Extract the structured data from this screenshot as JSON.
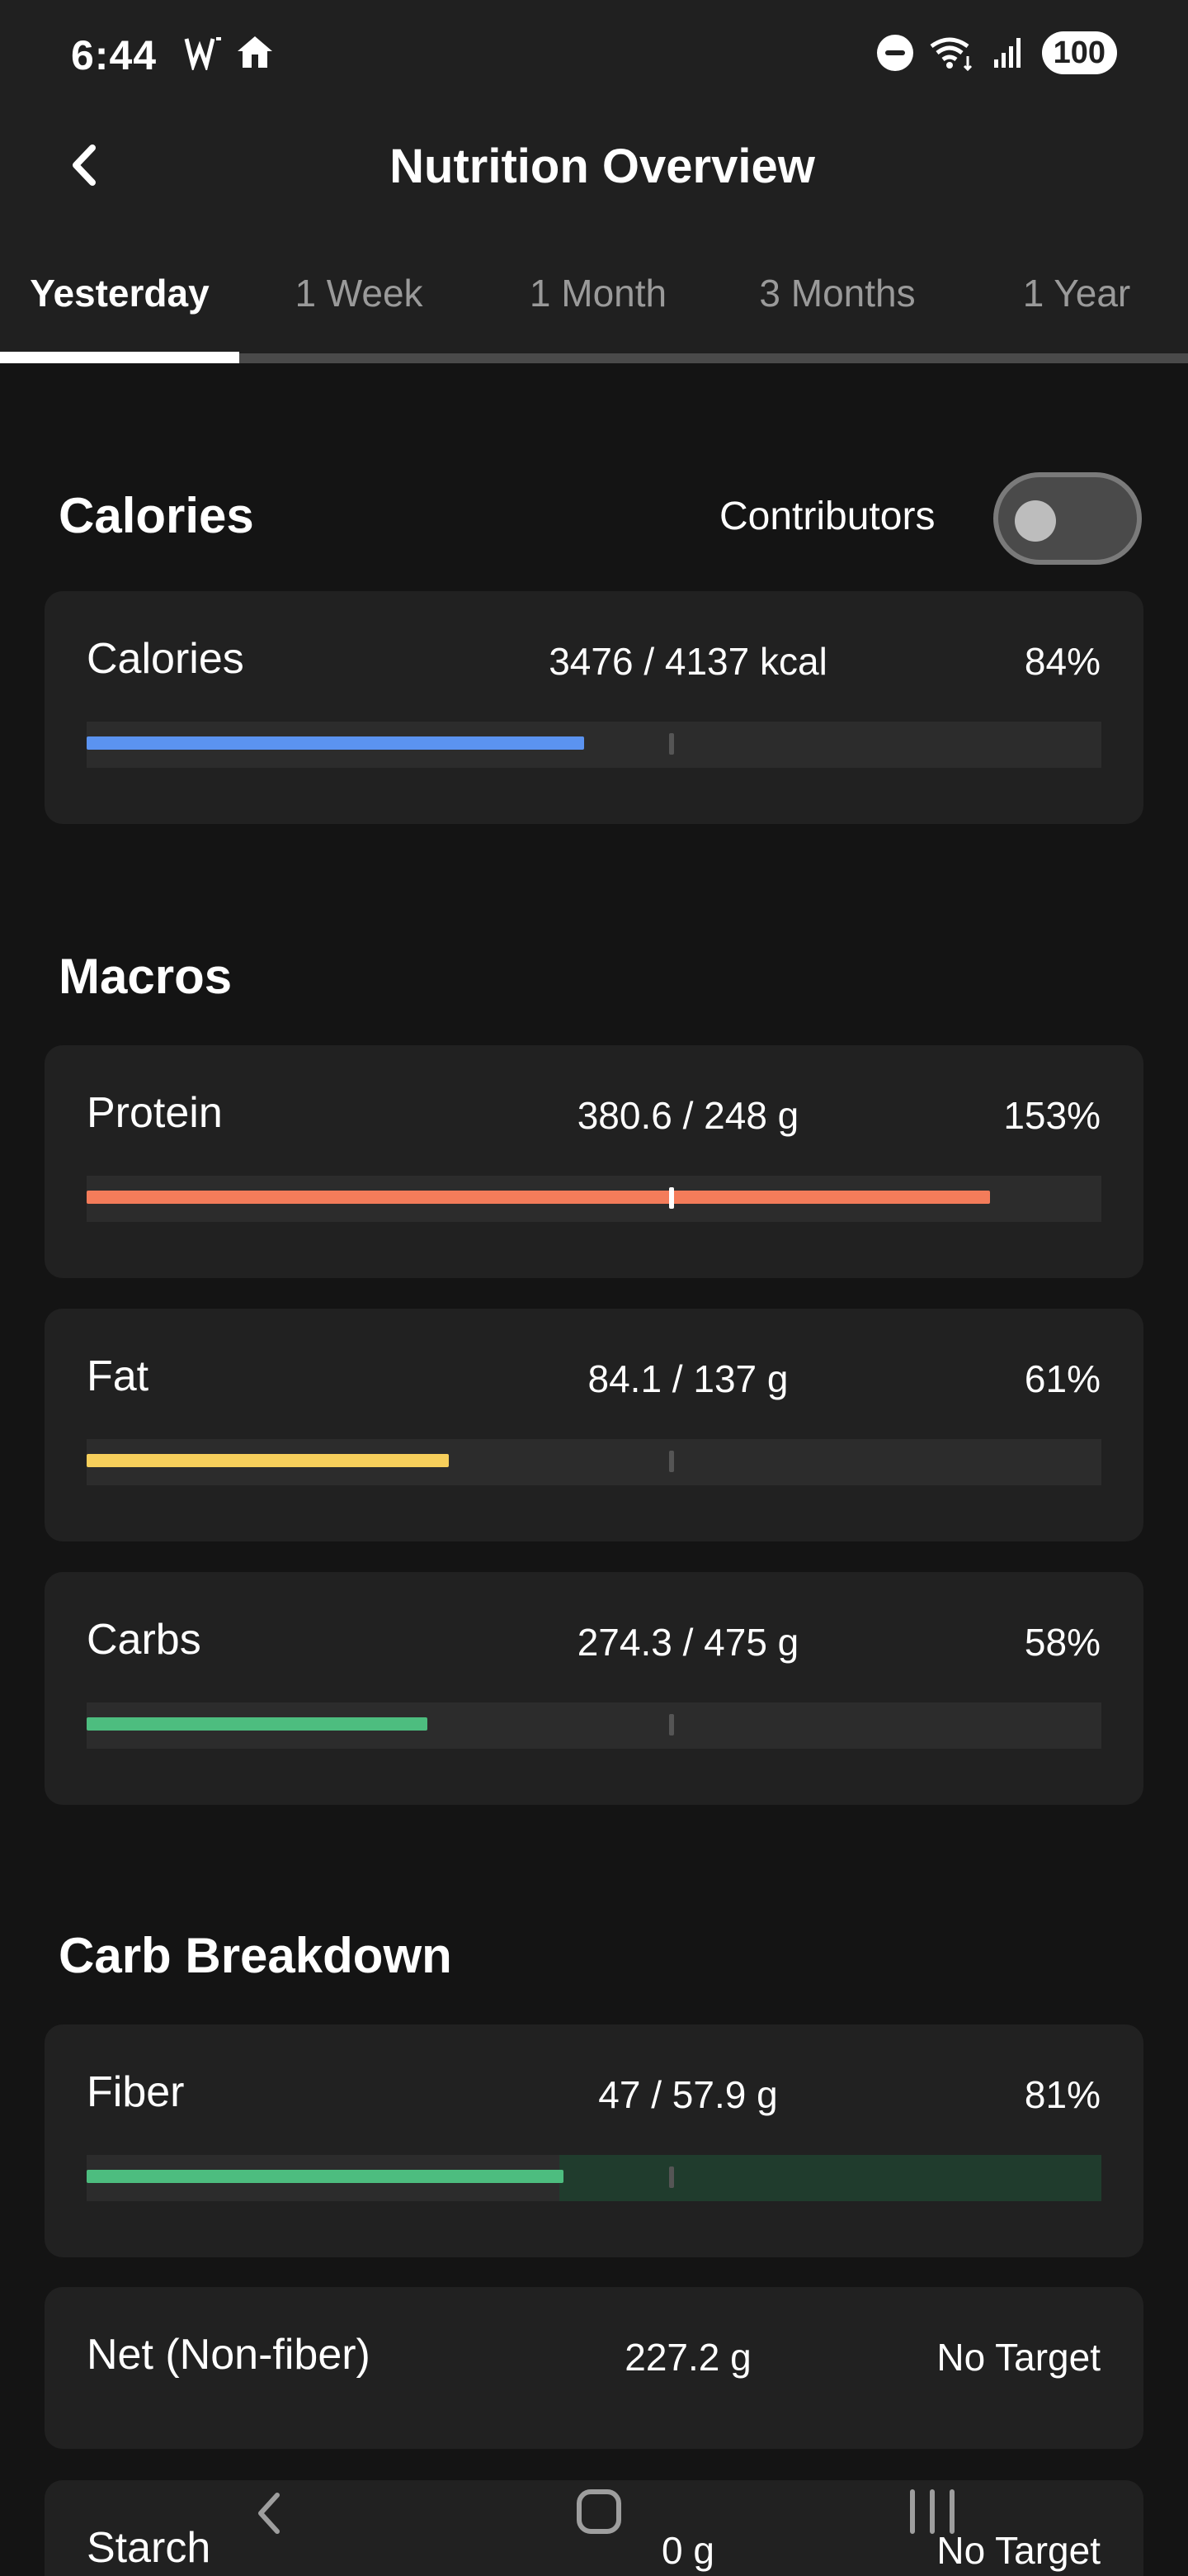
{
  "status_bar": {
    "time": "6:44",
    "battery": "100",
    "icons": [
      "carrier-icon",
      "home-icon",
      "do-not-disturb-icon",
      "wifi-icon",
      "signal-icon"
    ]
  },
  "header": {
    "title": "Nutrition Overview",
    "back_icon": "chevron-left-icon"
  },
  "tabs": [
    {
      "label": "Yesterday",
      "active": true
    },
    {
      "label": "1 Week",
      "active": false
    },
    {
      "label": "1 Month",
      "active": false
    },
    {
      "label": "3 Months",
      "active": false
    },
    {
      "label": "1 Year",
      "active": false
    }
  ],
  "calories_section": {
    "title": "Calories",
    "contributors_label": "Contributors",
    "contributors_on": false,
    "card": {
      "label": "Calories",
      "value": "3476 / 4137 kcal",
      "percent": "84%",
      "fill_fraction": 0.49,
      "color": "#5B93F0"
    }
  },
  "macros_section": {
    "title": "Macros",
    "cards": [
      {
        "label": "Protein",
        "value": "380.6 / 248 g",
        "percent": "153%",
        "fill_fraction": 0.89,
        "color": "#F47C5A"
      },
      {
        "label": "Fat",
        "value": "84.1 / 137 g",
        "percent": "61%",
        "fill_fraction": 0.357,
        "color": "#F7CF5B"
      },
      {
        "label": "Carbs",
        "value": "274.3 / 475 g",
        "percent": "58%",
        "fill_fraction": 0.336,
        "color": "#4DBD7F"
      }
    ]
  },
  "carb_section": {
    "title": "Carb Breakdown",
    "fiber": {
      "label": "Fiber",
      "value": "47 / 57.9 g",
      "percent": "81%",
      "fill_fraction": 0.47,
      "range_from": 0.466,
      "color": "#4DBD7F",
      "range_color": "#203C2D"
    },
    "net": {
      "label": "Net (Non-fiber)",
      "value": "227.2 g",
      "percent": "No Target"
    },
    "starch": {
      "label": "Starch",
      "value": "0 g",
      "percent": "No Target"
    }
  },
  "nav_bar": {
    "back_icon": "nav-back-icon",
    "home_icon": "nav-home-icon",
    "recents_icon": "nav-recents-icon"
  }
}
